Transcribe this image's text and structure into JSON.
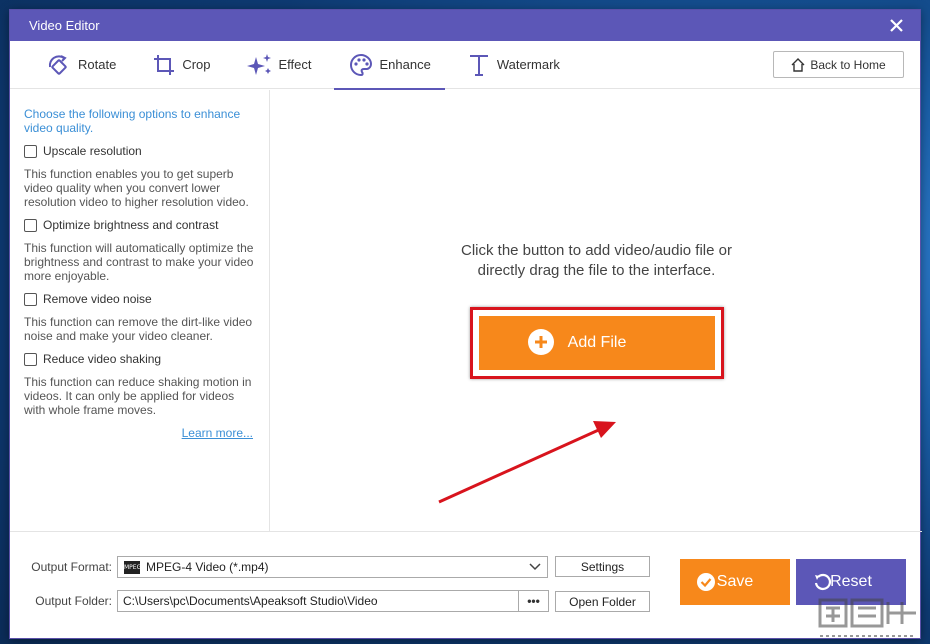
{
  "window": {
    "title": "Video Editor"
  },
  "tabs": [
    {
      "label": "Rotate",
      "icon": "rotate-icon"
    },
    {
      "label": "Crop",
      "icon": "crop-icon"
    },
    {
      "label": "Effect",
      "icon": "sparkle-icon"
    },
    {
      "label": "Enhance",
      "icon": "palette-icon",
      "active": true
    },
    {
      "label": "Watermark",
      "icon": "text-t-icon"
    }
  ],
  "toolbar": {
    "back_home_label": "Back to Home"
  },
  "sidebar": {
    "intro": "Choose the following options to enhance video quality.",
    "options": [
      {
        "label": "Upscale resolution",
        "checked": false,
        "desc": "This function enables you to get superb video quality when you convert lower resolution video to higher resolution video."
      },
      {
        "label": "Optimize brightness and contrast",
        "checked": false,
        "desc": "This function will automatically optimize the brightness and contrast to make your video more enjoyable."
      },
      {
        "label": "Remove video noise",
        "checked": false,
        "desc": "This function can remove the dirt-like video noise and make your video cleaner."
      },
      {
        "label": "Reduce video shaking",
        "checked": false,
        "desc": "This function can reduce shaking motion in videos. It can only be applied for videos with whole frame moves."
      }
    ],
    "learn_more": "Learn more..."
  },
  "main": {
    "hint_line1": "Click the button to add video/audio file or",
    "hint_line2": "directly drag the file to the interface.",
    "add_file_label": "Add File"
  },
  "bottom": {
    "output_format_label": "Output Format:",
    "output_format_value": "MPEG-4 Video (*.mp4)",
    "format_icon_text": "MPEG",
    "settings_label": "Settings",
    "output_folder_label": "Output Folder:",
    "output_folder_value": "C:\\Users\\pc\\Documents\\Apeaksoft Studio\\Video",
    "browse_label": "•••",
    "open_folder_label": "Open Folder",
    "save_label": "Save",
    "reset_label": "Reset"
  },
  "colors": {
    "accent_purple": "#5c57b7",
    "accent_orange": "#f7881b",
    "link_blue": "#3b8fd6",
    "highlight_red": "#d8141d"
  }
}
